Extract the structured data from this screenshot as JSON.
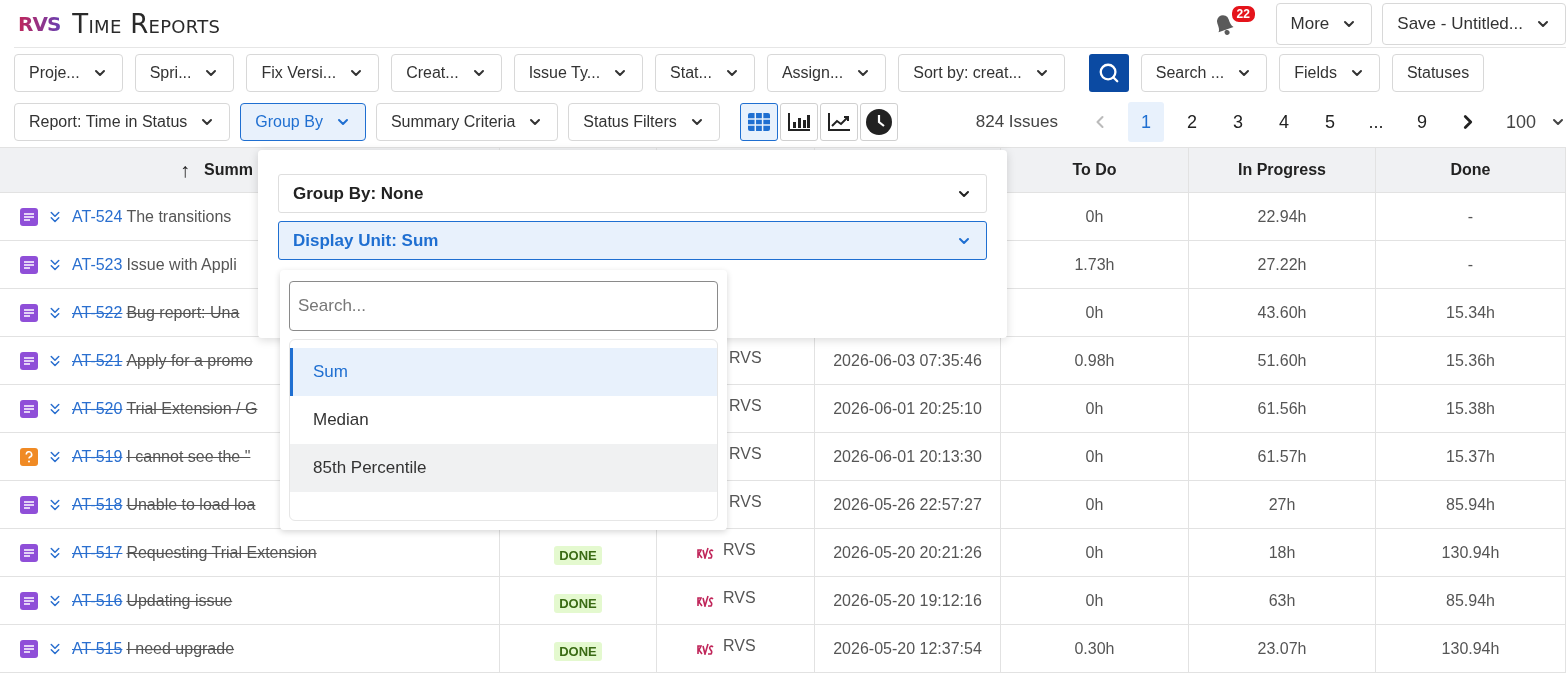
{
  "header": {
    "logo": "RVS",
    "title": "Time Reports",
    "notification_count": "22",
    "buttons": [
      {
        "label": "More"
      },
      {
        "label": "Save - Untitled..."
      }
    ]
  },
  "filters": [
    {
      "kind": "dropdown",
      "label": "Proje..."
    },
    {
      "kind": "dropdown",
      "label": "Spri..."
    },
    {
      "kind": "dropdown",
      "label": "Fix Versi..."
    },
    {
      "kind": "dropdown",
      "label": "Creat..."
    },
    {
      "kind": "dropdown",
      "label": "Issue Ty..."
    },
    {
      "kind": "dropdown",
      "label": "Stat..."
    },
    {
      "kind": "dropdown",
      "label": "Assign..."
    },
    {
      "kind": "dropdown",
      "label": "Sort by: creat..."
    },
    {
      "kind": "search"
    },
    {
      "kind": "dropdown",
      "label": "Search ..."
    },
    {
      "kind": "dropdown",
      "label": "Fields"
    },
    {
      "kind": "plain",
      "label": "Statuses"
    }
  ],
  "report_controls": [
    {
      "label": "Report: Time in Status",
      "selected": false
    },
    {
      "label": "Group By",
      "selected": true
    },
    {
      "label": "Summary Criteria",
      "selected": false
    },
    {
      "label": "Status Filters",
      "selected": false
    }
  ],
  "view_modes": [
    {
      "kind": "table",
      "selected": true
    },
    {
      "kind": "bar",
      "selected": false
    },
    {
      "kind": "line",
      "selected": false
    },
    {
      "kind": "clock",
      "selected": false
    }
  ],
  "issue_count": "824 Issues",
  "pagination": {
    "prev_disabled": true,
    "next_disabled": false,
    "pages": [
      {
        "label": "1",
        "selected": true
      },
      {
        "label": "2",
        "selected": false
      },
      {
        "label": "3",
        "selected": false
      },
      {
        "label": "4",
        "selected": false
      },
      {
        "label": "5",
        "selected": false
      },
      {
        "label": "...",
        "selected": false
      },
      {
        "label": "9",
        "selected": false
      }
    ],
    "page_size": "100"
  },
  "table": {
    "headers": {
      "sort_arrow": "↑",
      "summary": "Summ",
      "to_do": "To Do",
      "in_progress": "In Progress",
      "done": "Done"
    },
    "rows": [
      {
        "key": "AT-524",
        "summary": "The transitions",
        "kind": "story",
        "resolved": false,
        "to_do": "0h",
        "in_progress": "22.94h",
        "done": "-"
      },
      {
        "key": "AT-523",
        "summary": "Issue with Appli",
        "kind": "story",
        "resolved": false,
        "to_do": "1.73h",
        "in_progress": "27.22h",
        "done": "-"
      },
      {
        "key": "AT-522",
        "summary": "Bug report: Una",
        "kind": "story",
        "resolved": true,
        "to_do": "0h",
        "in_progress": "43.60h",
        "done": "15.34h"
      },
      {
        "key": "AT-521",
        "summary": "Apply for a promo",
        "kind": "story",
        "resolved": true,
        "assignee": "RVS",
        "avatar": false,
        "created": "2026-06-03 07:35:46",
        "to_do": "0.98h",
        "in_progress": "51.60h",
        "done": "15.36h"
      },
      {
        "key": "AT-520",
        "summary": "Trial Extension / G",
        "kind": "story",
        "resolved": true,
        "assignee": "RVS",
        "avatar": false,
        "created": "2026-06-01 20:25:10",
        "to_do": "0h",
        "in_progress": "61.56h",
        "done": "15.38h"
      },
      {
        "key": "AT-519",
        "summary": "I cannot see the \"",
        "kind": "question",
        "resolved": true,
        "assignee": "RVS",
        "avatar": false,
        "created": "2026-06-01 20:13:30",
        "to_do": "0h",
        "in_progress": "61.57h",
        "done": "15.37h"
      },
      {
        "key": "AT-518",
        "summary": "Unable to load loa",
        "kind": "story",
        "resolved": true,
        "assignee": "RVS",
        "avatar": false,
        "created": "2026-05-26 22:57:27",
        "to_do": "0h",
        "in_progress": "27h",
        "done": "85.94h"
      },
      {
        "key": "AT-517",
        "summary": "Requesting Trial Extension",
        "kind": "story",
        "resolved": true,
        "status": "DONE",
        "assignee": "RVS",
        "avatar": true,
        "created": "2026-05-20 20:21:26",
        "to_do": "0h",
        "in_progress": "18h",
        "done": "130.94h"
      },
      {
        "key": "AT-516",
        "summary": "Updating issue",
        "kind": "story",
        "resolved": true,
        "status": "DONE",
        "assignee": "RVS",
        "avatar": true,
        "created": "2026-05-20 19:12:16",
        "to_do": "0h",
        "in_progress": "63h",
        "done": "85.94h"
      },
      {
        "key": "AT-515",
        "summary": "I need upgrade",
        "kind": "story",
        "resolved": true,
        "status": "DONE",
        "assignee": "RVS",
        "avatar": true,
        "created": "2026-05-20 12:37:54",
        "to_do": "0.30h",
        "in_progress": "23.07h",
        "done": "130.94h"
      }
    ]
  },
  "group_by_popup": {
    "selects": [
      {
        "label": "Group By: None",
        "open": false
      },
      {
        "label": "Display Unit: Sum",
        "open": true
      }
    ],
    "dropdown": {
      "search_placeholder": "Search...",
      "options": [
        {
          "label": "Sum",
          "selected": true,
          "hovered": false
        },
        {
          "label": "Median",
          "selected": false,
          "hovered": false
        },
        {
          "label": "85th Percentile",
          "selected": false,
          "hovered": true
        }
      ]
    }
  }
}
